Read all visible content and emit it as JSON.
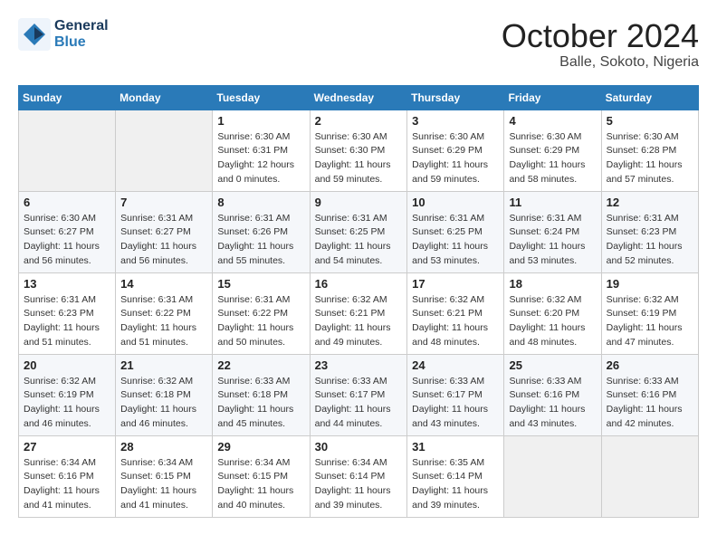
{
  "logo": {
    "general": "General",
    "blue": "Blue"
  },
  "title": "October 2024",
  "location": "Balle, Sokoto, Nigeria",
  "days_header": [
    "Sunday",
    "Monday",
    "Tuesday",
    "Wednesday",
    "Thursday",
    "Friday",
    "Saturday"
  ],
  "weeks": [
    [
      {
        "day": "",
        "info": ""
      },
      {
        "day": "",
        "info": ""
      },
      {
        "day": "1",
        "info": "Sunrise: 6:30 AM\nSunset: 6:31 PM\nDaylight: 12 hours\nand 0 minutes."
      },
      {
        "day": "2",
        "info": "Sunrise: 6:30 AM\nSunset: 6:30 PM\nDaylight: 11 hours\nand 59 minutes."
      },
      {
        "day": "3",
        "info": "Sunrise: 6:30 AM\nSunset: 6:29 PM\nDaylight: 11 hours\nand 59 minutes."
      },
      {
        "day": "4",
        "info": "Sunrise: 6:30 AM\nSunset: 6:29 PM\nDaylight: 11 hours\nand 58 minutes."
      },
      {
        "day": "5",
        "info": "Sunrise: 6:30 AM\nSunset: 6:28 PM\nDaylight: 11 hours\nand 57 minutes."
      }
    ],
    [
      {
        "day": "6",
        "info": "Sunrise: 6:30 AM\nSunset: 6:27 PM\nDaylight: 11 hours\nand 56 minutes."
      },
      {
        "day": "7",
        "info": "Sunrise: 6:31 AM\nSunset: 6:27 PM\nDaylight: 11 hours\nand 56 minutes."
      },
      {
        "day": "8",
        "info": "Sunrise: 6:31 AM\nSunset: 6:26 PM\nDaylight: 11 hours\nand 55 minutes."
      },
      {
        "day": "9",
        "info": "Sunrise: 6:31 AM\nSunset: 6:25 PM\nDaylight: 11 hours\nand 54 minutes."
      },
      {
        "day": "10",
        "info": "Sunrise: 6:31 AM\nSunset: 6:25 PM\nDaylight: 11 hours\nand 53 minutes."
      },
      {
        "day": "11",
        "info": "Sunrise: 6:31 AM\nSunset: 6:24 PM\nDaylight: 11 hours\nand 53 minutes."
      },
      {
        "day": "12",
        "info": "Sunrise: 6:31 AM\nSunset: 6:23 PM\nDaylight: 11 hours\nand 52 minutes."
      }
    ],
    [
      {
        "day": "13",
        "info": "Sunrise: 6:31 AM\nSunset: 6:23 PM\nDaylight: 11 hours\nand 51 minutes."
      },
      {
        "day": "14",
        "info": "Sunrise: 6:31 AM\nSunset: 6:22 PM\nDaylight: 11 hours\nand 51 minutes."
      },
      {
        "day": "15",
        "info": "Sunrise: 6:31 AM\nSunset: 6:22 PM\nDaylight: 11 hours\nand 50 minutes."
      },
      {
        "day": "16",
        "info": "Sunrise: 6:32 AM\nSunset: 6:21 PM\nDaylight: 11 hours\nand 49 minutes."
      },
      {
        "day": "17",
        "info": "Sunrise: 6:32 AM\nSunset: 6:21 PM\nDaylight: 11 hours\nand 48 minutes."
      },
      {
        "day": "18",
        "info": "Sunrise: 6:32 AM\nSunset: 6:20 PM\nDaylight: 11 hours\nand 48 minutes."
      },
      {
        "day": "19",
        "info": "Sunrise: 6:32 AM\nSunset: 6:19 PM\nDaylight: 11 hours\nand 47 minutes."
      }
    ],
    [
      {
        "day": "20",
        "info": "Sunrise: 6:32 AM\nSunset: 6:19 PM\nDaylight: 11 hours\nand 46 minutes."
      },
      {
        "day": "21",
        "info": "Sunrise: 6:32 AM\nSunset: 6:18 PM\nDaylight: 11 hours\nand 46 minutes."
      },
      {
        "day": "22",
        "info": "Sunrise: 6:33 AM\nSunset: 6:18 PM\nDaylight: 11 hours\nand 45 minutes."
      },
      {
        "day": "23",
        "info": "Sunrise: 6:33 AM\nSunset: 6:17 PM\nDaylight: 11 hours\nand 44 minutes."
      },
      {
        "day": "24",
        "info": "Sunrise: 6:33 AM\nSunset: 6:17 PM\nDaylight: 11 hours\nand 43 minutes."
      },
      {
        "day": "25",
        "info": "Sunrise: 6:33 AM\nSunset: 6:16 PM\nDaylight: 11 hours\nand 43 minutes."
      },
      {
        "day": "26",
        "info": "Sunrise: 6:33 AM\nSunset: 6:16 PM\nDaylight: 11 hours\nand 42 minutes."
      }
    ],
    [
      {
        "day": "27",
        "info": "Sunrise: 6:34 AM\nSunset: 6:16 PM\nDaylight: 11 hours\nand 41 minutes."
      },
      {
        "day": "28",
        "info": "Sunrise: 6:34 AM\nSunset: 6:15 PM\nDaylight: 11 hours\nand 41 minutes."
      },
      {
        "day": "29",
        "info": "Sunrise: 6:34 AM\nSunset: 6:15 PM\nDaylight: 11 hours\nand 40 minutes."
      },
      {
        "day": "30",
        "info": "Sunrise: 6:34 AM\nSunset: 6:14 PM\nDaylight: 11 hours\nand 39 minutes."
      },
      {
        "day": "31",
        "info": "Sunrise: 6:35 AM\nSunset: 6:14 PM\nDaylight: 11 hours\nand 39 minutes."
      },
      {
        "day": "",
        "info": ""
      },
      {
        "day": "",
        "info": ""
      }
    ]
  ]
}
